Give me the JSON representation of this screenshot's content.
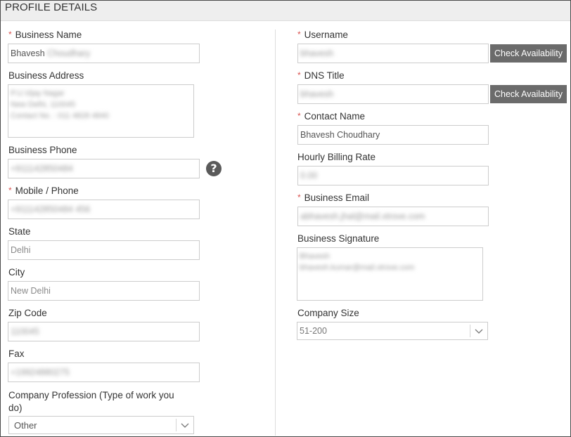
{
  "header": {
    "title": "PROFILE DETAILS"
  },
  "left": {
    "business_name": {
      "label": "Business Name",
      "value": "Bhavesh Choudhary",
      "required": "*"
    },
    "business_address": {
      "label": "Business Address",
      "lines": [
        "P.U.Vijay Nagar",
        "New Delhi, 110045",
        "Contact No. : 011 4828 4840"
      ]
    },
    "business_phone": {
      "label": "Business Phone",
      "value": "+911142850484",
      "help_icon": "question-circle-icon"
    },
    "mobile_phone": {
      "label": "Mobile / Phone",
      "value": "+911142850484 456",
      "required": "*"
    },
    "state": {
      "label": "State",
      "value": "Delhi"
    },
    "city": {
      "label": "City",
      "value": "New Delhi"
    },
    "zip_code": {
      "label": "Zip Code",
      "value": "110045"
    },
    "fax": {
      "label": "Fax",
      "value": "+19924880275"
    },
    "company_profession": {
      "label": "Company Profession (Type of work you do)",
      "value": "Other"
    }
  },
  "right": {
    "username": {
      "label": "Username",
      "value": "bhavesh",
      "required": "*",
      "button": "Check Availability"
    },
    "dns_title": {
      "label": "DNS Title",
      "value": "bhavesh",
      "required": "*",
      "button": "Check Availability"
    },
    "contact_name": {
      "label": "Contact Name",
      "value": "Bhavesh Choudhary",
      "required": "*"
    },
    "hourly_billing_rate": {
      "label": "Hourly Billing Rate",
      "value": "0.00"
    },
    "business_email": {
      "label": "Business Email",
      "value": "abhavesh.jhal@mail.xtrove.com",
      "required": "*"
    },
    "business_signature": {
      "label": "Business Signature",
      "lines": [
        "Bhavesh",
        "bhavesh.kumar@mail.xtrove.com"
      ]
    },
    "company_size": {
      "label": "Company Size",
      "value": "51-200"
    }
  },
  "colors": {
    "required": "#d9534f",
    "button_bg": "#6b6b6b",
    "header_bg": "#eeeeee"
  }
}
